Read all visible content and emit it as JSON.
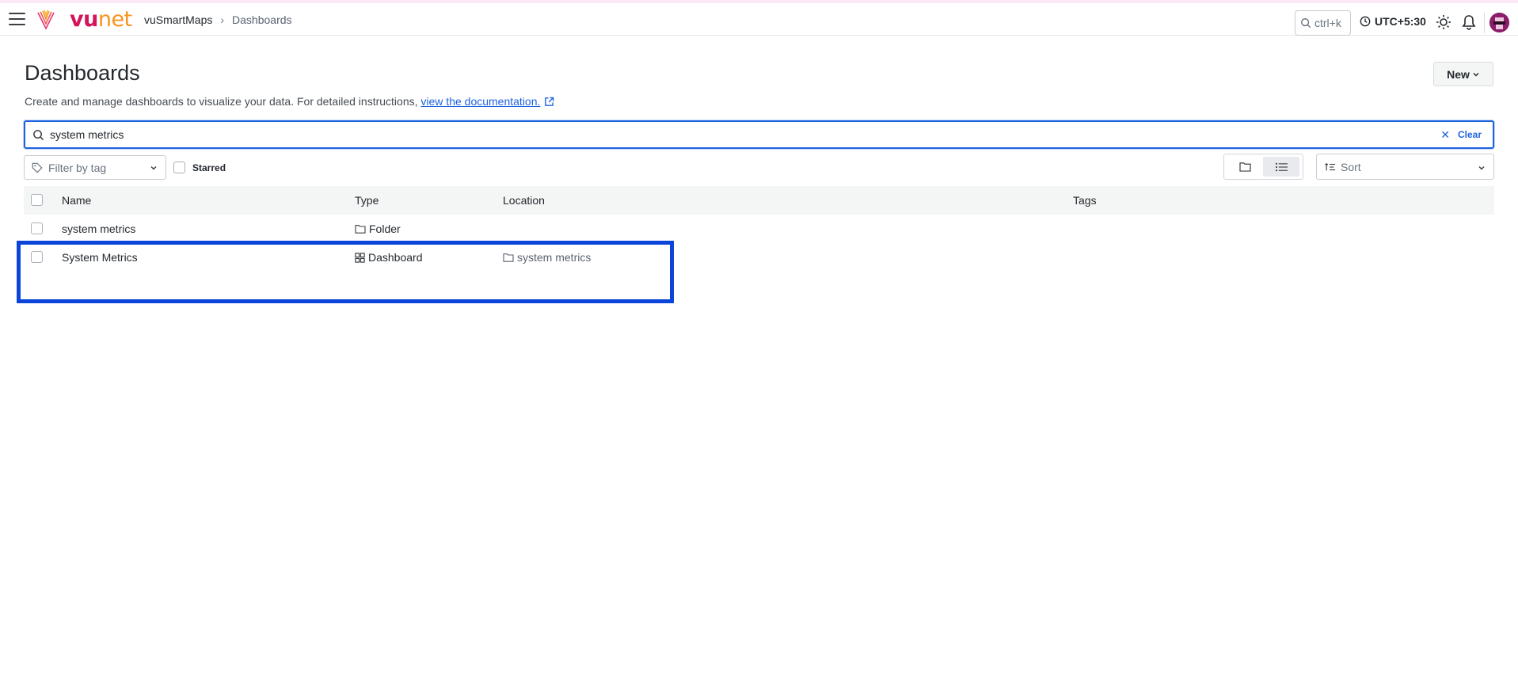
{
  "topbar": {
    "brand_vu": "vu",
    "brand_net": "net",
    "breadcrumb_root": "vuSmartMaps",
    "breadcrumb_current": "Dashboards",
    "search_shortcut": "ctrl+k",
    "timezone": "UTC+5:30",
    "icons": [
      "menu-icon",
      "search-icon",
      "clock-icon",
      "sun-icon",
      "bell-icon",
      "avatar"
    ]
  },
  "page": {
    "title": "Dashboards",
    "subtitle": "Create and manage dashboards to visualize your data. For detailed instructions, ",
    "doc_link": "view the documentation.",
    "new_button": "New"
  },
  "search": {
    "value": "system metrics",
    "clear_label": "Clear"
  },
  "filters": {
    "tag_placeholder": "Filter by tag",
    "starred_label": "Starred",
    "starred_checked": false,
    "view_mode": "list",
    "sort_placeholder": "Sort"
  },
  "table": {
    "headers": [
      "Name",
      "Type",
      "Location",
      "Tags"
    ],
    "rows": [
      {
        "name": "system metrics",
        "type": "Folder",
        "type_icon": "folder-icon",
        "location": "",
        "tags": ""
      },
      {
        "name": "System Metrics",
        "type": "Dashboard",
        "type_icon": "dashboard-grid-icon",
        "location": "system metrics",
        "location_icon": "folder-icon",
        "tags": ""
      }
    ]
  },
  "colors": {
    "accent": "#1f62e0",
    "highlight_box": "#0a44d8",
    "brand_magenta": "#d4145a",
    "brand_orange": "#f7931e"
  }
}
